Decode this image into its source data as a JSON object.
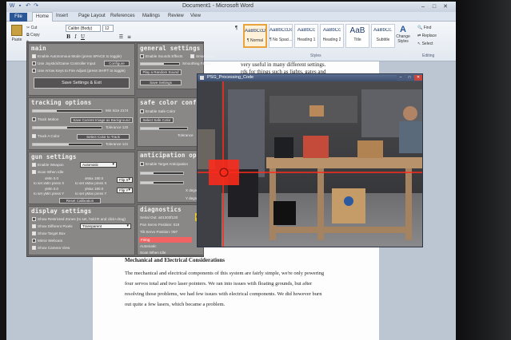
{
  "word": {
    "title": "Document1 - Microsoft Word",
    "tabs": [
      "File",
      "Home",
      "Insert",
      "Page Layout",
      "References",
      "Mailings",
      "Review",
      "View"
    ],
    "active_tab": "Home",
    "clipboard": {
      "paste": "Paste",
      "cut": "Cut",
      "copy": "Copy"
    },
    "font": {
      "name": "Calibri (Body)",
      "size": "12"
    },
    "styles": [
      {
        "sample": "AaBbCcDc",
        "name": "¶ Normal"
      },
      {
        "sample": "AaBbCcDc",
        "name": "¶ No Spaci..."
      },
      {
        "sample": "AaBbCc",
        "name": "Heading 1"
      },
      {
        "sample": "AaBbCc",
        "name": "Heading 2"
      },
      {
        "sample": "AaB",
        "name": "Title"
      },
      {
        "sample": "AaBbCc.",
        "name": "Subtitle"
      }
    ],
    "change_styles": "Change Styles",
    "editing": {
      "find": "Find",
      "replace": "Replace",
      "select": "Select"
    },
    "group_labels": {
      "styles": "Styles",
      "editing": "Editing"
    }
  },
  "document": {
    "top_lines": [
      "very useful in many different settings.",
      "rds for things such as lights, gates and"
    ],
    "heading": "Mechanical and Electrical Considerations",
    "paragraph": [
      "The mechanical and electrical components of this system are fairly simple, we're only powering",
      "four servos total and two laser pointers. We ran into issues with floating grounds, but after",
      "resolving those problems, we had few issues with electrical components. We did however burn",
      "out quite a few lasers, which became a problem."
    ]
  },
  "gui": {
    "main": {
      "title": "main",
      "options": [
        {
          "label": "Enable Autonomous Mode (press SPACE to toggle)",
          "checked": true
        },
        {
          "label": "Use Joystick/Game Controller Input",
          "checked": false
        },
        {
          "label": "Use Arrow Keys to Fire Adjust (press SHIFT to toggle)",
          "checked": false
        }
      ],
      "configure_button": "Configure",
      "save_button": "Save Settings & Exit"
    },
    "general": {
      "title": "general settings",
      "options": [
        {
          "label": "Enable Sounds Effects",
          "checked": false
        },
        {
          "label": "Smoothing",
          "checked": true
        }
      ],
      "smoothing_label": "Smoothing Factor",
      "smoothing_value": 0.6,
      "random_sound_button": "Play a Random Sound",
      "save_button": "Save Settings"
    },
    "tracking": {
      "title": "tracking options",
      "min_size_label": "Min Size 2174",
      "min_size_value": 0.35,
      "track_motion": {
        "label": "Track Motion",
        "checked": false
      },
      "bg_button": "Save Current Image as Background",
      "tolerance1_label": "Tolerance 120",
      "tolerance1_value": 0.5,
      "track_color": {
        "label": "Track A Color",
        "checked": true
      },
      "color_button": "Select Color to Track",
      "tolerance2_label": "Tolerance 121",
      "tolerance2_value": 0.52
    },
    "safe": {
      "title": "safe color configu",
      "enable": {
        "label": "Enable Safe Color",
        "checked": false
      },
      "select_button": "Select Safe Color",
      "tolerance_label": "Tolerance"
    },
    "gun": {
      "title": "gun settings",
      "weapon": {
        "label": "Enable Weapon",
        "checked": true
      },
      "scan": {
        "label": "Scan When Idle",
        "checked": true
      },
      "mode": "Automatic",
      "xmin_label": "xMin 0.0",
      "xmax_label": "xMax 180.0",
      "ymin_label": "yMin 0.0",
      "ymax_label": "yMax 180.0",
      "set_xmin": "to set xMin press X",
      "set_xmax": "to set xMax press X",
      "set_ymin": "to set yMin press Y",
      "set_ymax": "to set yMax press Y",
      "flip_x": "Flip X",
      "flip_y": "Flip Y",
      "reset_button": "Reset Calibration"
    },
    "anticipation": {
      "title": "anticipation optio",
      "enable": {
        "label": "Enable Target Anticipation",
        "checked": false
      },
      "x_label": "X degree",
      "y_label": "Y degree"
    },
    "display": {
      "title": "display settings",
      "options": [
        {
          "label": "Show Restricted Zones (to set, hold R and click+drag)",
          "checked": false
        },
        {
          "label": "Show Different Pixels",
          "checked": true
        },
        {
          "label": "Show Target Box",
          "checked": true
        },
        {
          "label": "Mirror Webcam",
          "checked": false
        },
        {
          "label": "Show Camera View",
          "checked": true
        }
      ],
      "pixels_mode": "Transparent"
    },
    "diagnostics": {
      "title": "diagnostics",
      "lines": [
        "Serial Out: a01303f130",
        "Pan Servo Position: 019",
        "Tilt Servo Position: 097"
      ],
      "firing": "Firing",
      "status": "Automatic",
      "scan": "Scan When Idle",
      "swatch_label": "Cor"
    }
  },
  "camera_window": {
    "title": "PSG_Processing_Code",
    "target_color": "#ff2a1a"
  },
  "colors": {
    "gui_bg": "#6e6c6c",
    "panel_bg": "#8a8787",
    "word_file_tab": "#2b5797",
    "firing": "#f26464",
    "target": "#ff2a1a"
  }
}
